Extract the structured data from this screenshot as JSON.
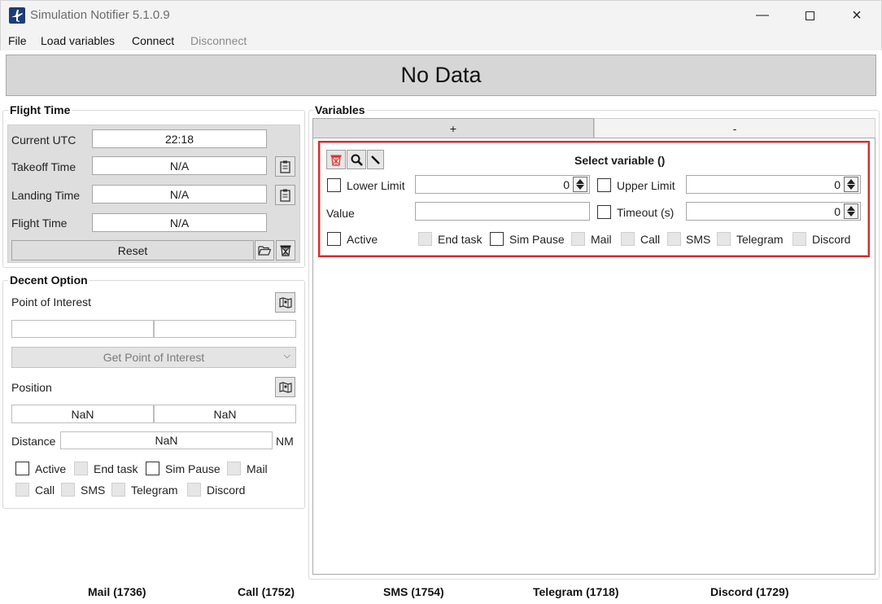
{
  "window": {
    "title": "Simulation Notifier 5.1.0.9"
  },
  "menu": {
    "file": "File",
    "load_variables": "Load variables",
    "connect": "Connect",
    "disconnect": "Disconnect"
  },
  "status_banner": "No Data",
  "flight_time": {
    "title": "Flight Time",
    "current_utc_label": "Current UTC",
    "current_utc_value": "22:18",
    "takeoff_label": "Takeoff Time",
    "takeoff_value": "N/A",
    "landing_label": "Landing Time",
    "landing_value": "N/A",
    "flight_label": "Flight Time",
    "flight_value": "N/A",
    "reset_label": "Reset"
  },
  "descent": {
    "title": "Decent Option",
    "poi_label": "Point of Interest",
    "poi_value_1": "",
    "poi_value_2": "",
    "get_poi_label": "Get Point of Interest",
    "position_label": "Position",
    "position_value_1": "NaN",
    "position_value_2": "NaN",
    "distance_label": "Distance",
    "distance_value": "NaN",
    "distance_unit": "NM",
    "checks": {
      "active": "Active",
      "end_task": "End task",
      "sim_pause": "Sim Pause",
      "mail": "Mail",
      "call": "Call",
      "sms": "SMS",
      "telegram": "Telegram",
      "discord": "Discord"
    }
  },
  "variables": {
    "title": "Variables",
    "add_tab": "+",
    "remove_tab": "-",
    "card": {
      "select_label": "Select variable ()",
      "lower_limit_label": "Lower Limit",
      "lower_limit_value": "0",
      "upper_limit_label": "Upper Limit",
      "upper_limit_value": "0",
      "value_label": "Value",
      "value_value": "",
      "timeout_label": "Timeout (s)",
      "timeout_value": "0",
      "checks": {
        "active": "Active",
        "end_task": "End task",
        "sim_pause": "Sim Pause",
        "mail": "Mail",
        "call": "Call",
        "sms": "SMS",
        "telegram": "Telegram",
        "discord": "Discord"
      }
    }
  },
  "footer": {
    "mail": "Mail (1736)",
    "call": "Call (1752)",
    "sms": "SMS (1754)",
    "telegram": "Telegram (1718)",
    "discord": "Discord (1729)"
  },
  "icons": {
    "app": "airplane-icon",
    "minimize": "minimize-icon",
    "maximize": "maximize-icon",
    "close": "close-icon",
    "clipboard": "clipboard-icon",
    "folder": "folder-open-icon",
    "trash": "trash-icon",
    "map": "map-icon",
    "search": "magnifier-icon",
    "pick": "pencil-icon"
  },
  "colors": {
    "card_border": "#d62b2b",
    "trash_red": "#e03030",
    "app_icon": "#1d3c78"
  }
}
